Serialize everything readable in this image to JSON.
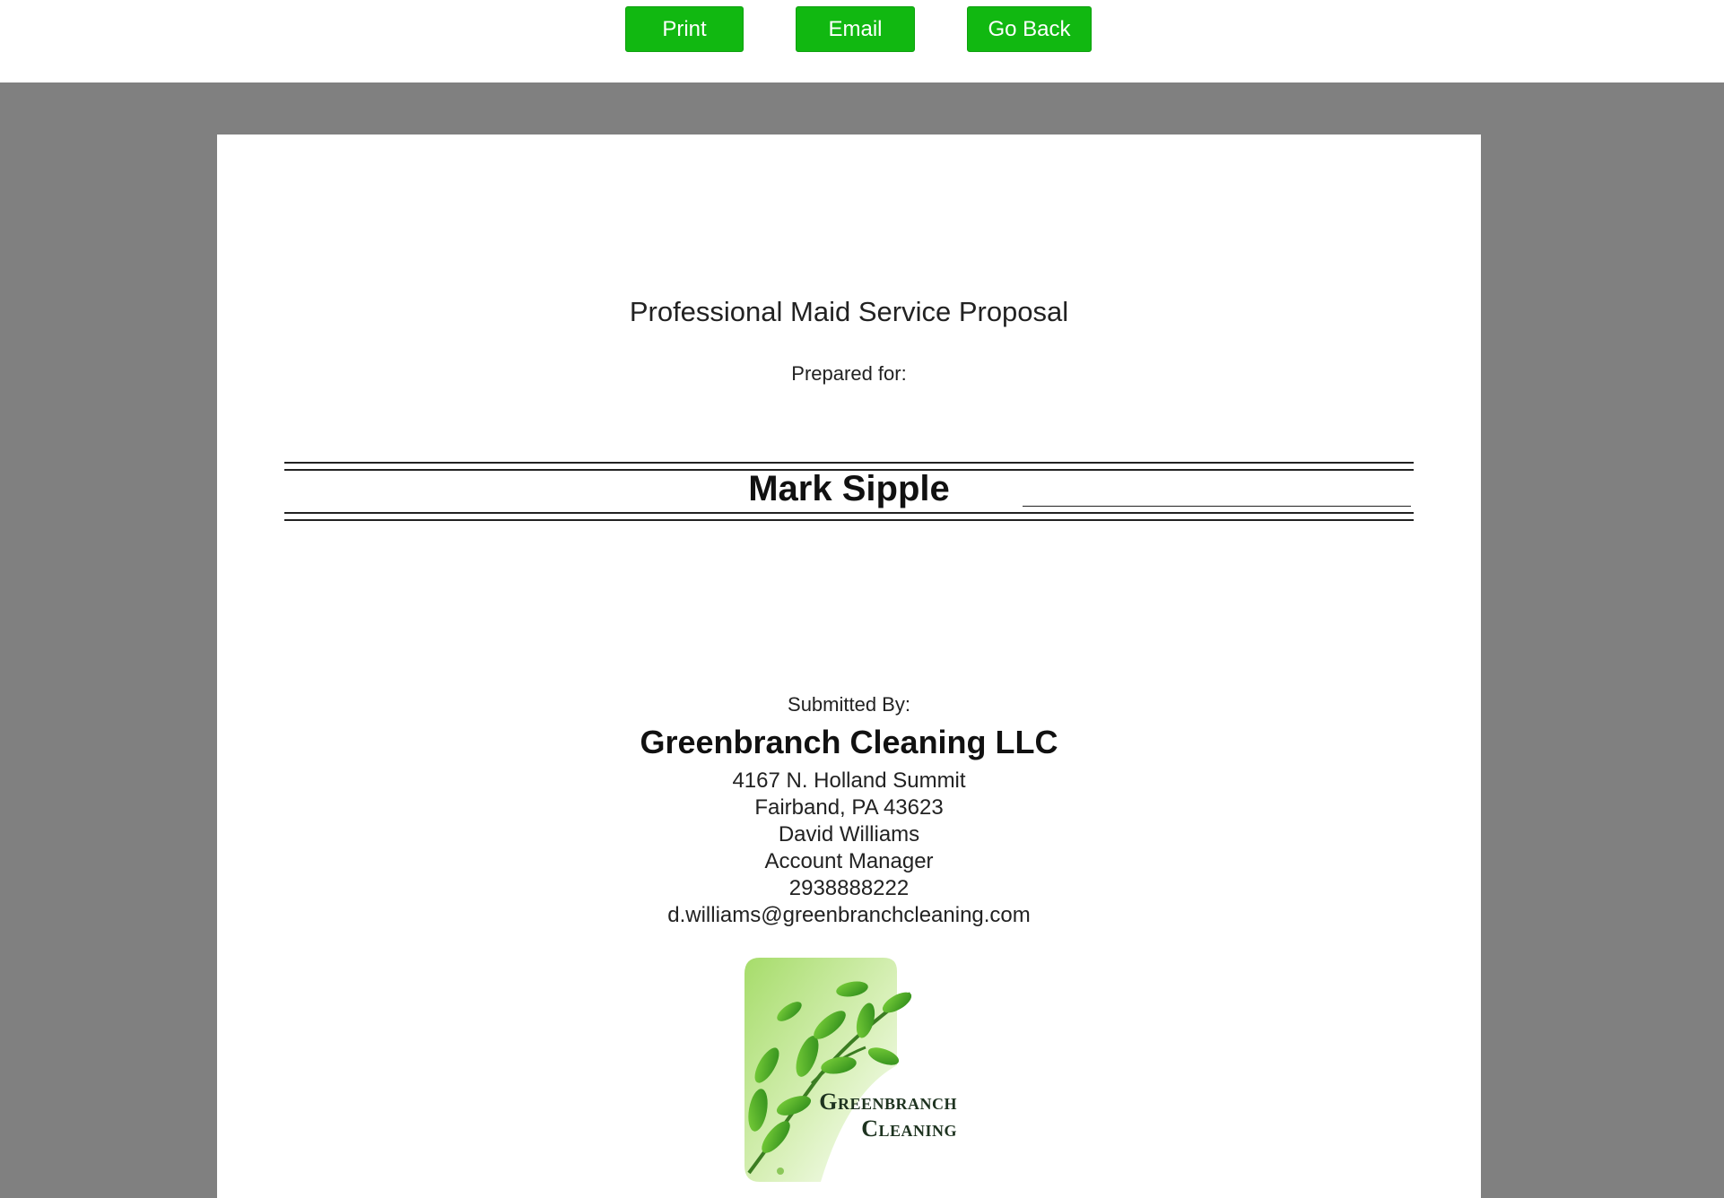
{
  "toolbar": {
    "print_label": "Print",
    "email_label": "Email",
    "back_label": "Go Back"
  },
  "document": {
    "title": "Professional Maid Service Proposal",
    "prepared_for_label": "Prepared for:",
    "client_name": "Mark Sipple",
    "submitted_by_label": "Submitted By:",
    "company_name": "Greenbranch Cleaning LLC",
    "address_line1": "4167 N. Holland Summit",
    "address_line2": "Fairband, PA 43623",
    "contact_name": "David Williams",
    "contact_title": "Account Manager",
    "phone": "2938888222",
    "email": "d.williams@greenbranchcleaning.com",
    "logo": {
      "line1": "Greenbranch",
      "line2": "Cleaning"
    }
  },
  "colors": {
    "button_green": "#11b811",
    "viewer_gray": "#808080",
    "page_white": "#ffffff"
  }
}
